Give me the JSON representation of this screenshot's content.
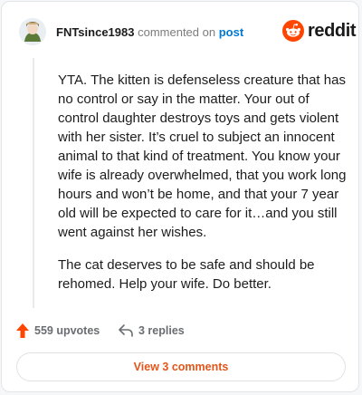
{
  "header": {
    "username": "FNTsince1983",
    "action_text": "commented on",
    "post_link": "post",
    "brand": "reddit"
  },
  "icons": {
    "avatar": "avatar-icon",
    "logo": "reddit-logo-icon",
    "upvote": "upvote-arrow-icon",
    "reply": "reply-arrow-icon"
  },
  "colors": {
    "brand": "#ff4500",
    "link": "#0079d3",
    "upvote": "#ff4500",
    "view_button_text": "#e2551b"
  },
  "comment": {
    "paragraphs": [
      "YTA. The kitten is defenseless creature that has no control or say in the matter. Your out of control daughter destroys toys and gets violent with her sister. It’s cruel to subject an innocent animal to that kind of treatment. You know your wife is already overwhelmed, that you work long hours and won’t be home, and that your 7 year old will be expected to care for it…and you still went against her wishes.",
      "The cat deserves to be safe and should be rehomed. Help your wife. Do better."
    ]
  },
  "footer": {
    "upvotes_label": "559 upvotes",
    "replies_label": "3 replies",
    "view_comments_label": "View 3 comments"
  }
}
